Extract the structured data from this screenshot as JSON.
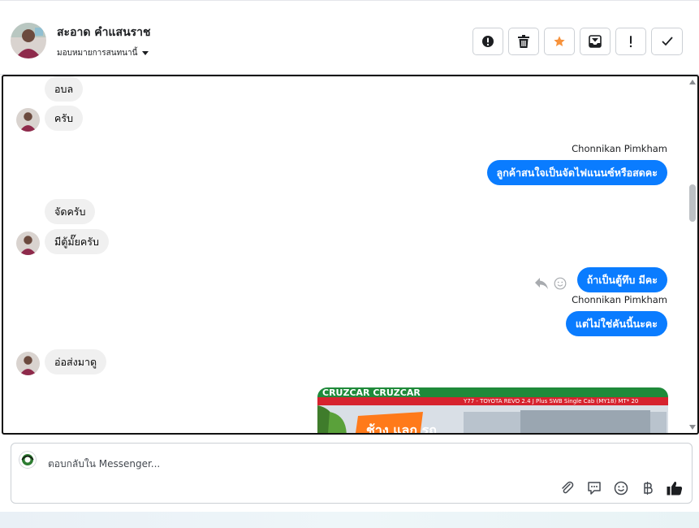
{
  "header": {
    "contact_name": "สะอาด คำแสนราช",
    "assign_label": "มอบหมายการสนทนานี้"
  },
  "toolbar": {
    "buttons": [
      {
        "name": "spam",
        "icon": "alert-circle-icon"
      },
      {
        "name": "delete",
        "icon": "trash-icon"
      },
      {
        "name": "star",
        "icon": "star-icon",
        "color": "#f7923b"
      },
      {
        "name": "archive",
        "icon": "archive-icon"
      },
      {
        "name": "follow-up",
        "icon": "exclamation-icon"
      },
      {
        "name": "done",
        "icon": "checkmark-icon"
      }
    ]
  },
  "messages": [
    {
      "side": "in",
      "text": "อบล"
    },
    {
      "side": "in",
      "text": "ครับ"
    },
    {
      "side": "out",
      "sender": "Chonnikan Pimkham",
      "text": "ลูกค้าสนใจเป็นจัดไฟแนนซ์หรือสดคะ"
    },
    {
      "side": "in",
      "text": "จัดครับ"
    },
    {
      "side": "in",
      "text": "มีตู้มั๊ยครับ"
    },
    {
      "side": "out",
      "text": "ถ้าเป็นตู้ทึบ มีคะ"
    },
    {
      "side": "out",
      "sender": "Chonnikan Pimkham",
      "text": "แต่ไม่ใช่คันนี้นะคะ"
    },
    {
      "side": "in",
      "text": "อ่อส่งมาดู"
    }
  ],
  "image_attachment": {
    "caption": "Y77 - TOYOTA REVO 2.4 J Plus SWB Single Cab (MY18) MT* 20"
  },
  "composer": {
    "placeholder": "ตอบกลับใน Messenger..."
  },
  "colors": {
    "outgoing_bubble": "#0a7cff",
    "incoming_bubble": "#f0f0f0"
  }
}
